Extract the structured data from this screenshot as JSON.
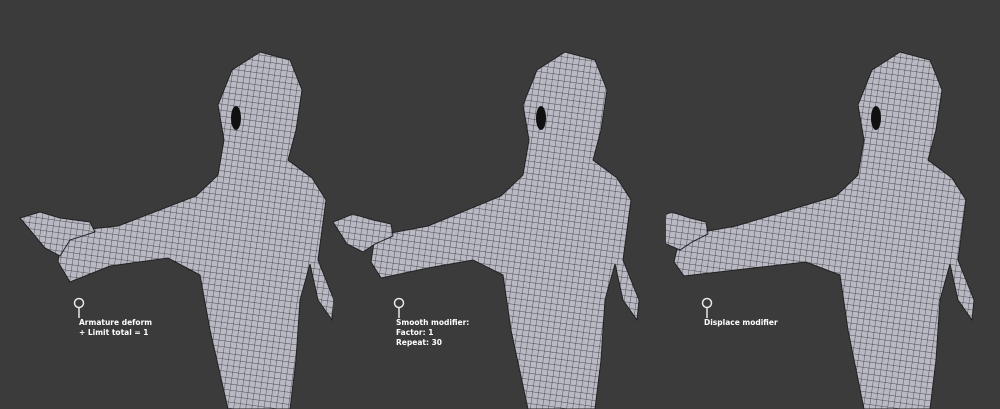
{
  "panels": [
    {
      "id": "armature",
      "lines": [
        "Armature deform",
        "+ Limit total = 1"
      ]
    },
    {
      "id": "smooth",
      "lines": [
        "Smooth modifier:",
        "Factor: 1",
        "Repeat: 30"
      ]
    },
    {
      "id": "displace",
      "lines": [
        "Displace modifier"
      ]
    }
  ],
  "colors": {
    "background": "#3b3b3b",
    "mesh_fill": "#b9b9c4",
    "mesh_wire": "#2a2a2e",
    "caption_text": "#ffffff"
  },
  "icons": {
    "pin": "map-pin-icon"
  }
}
